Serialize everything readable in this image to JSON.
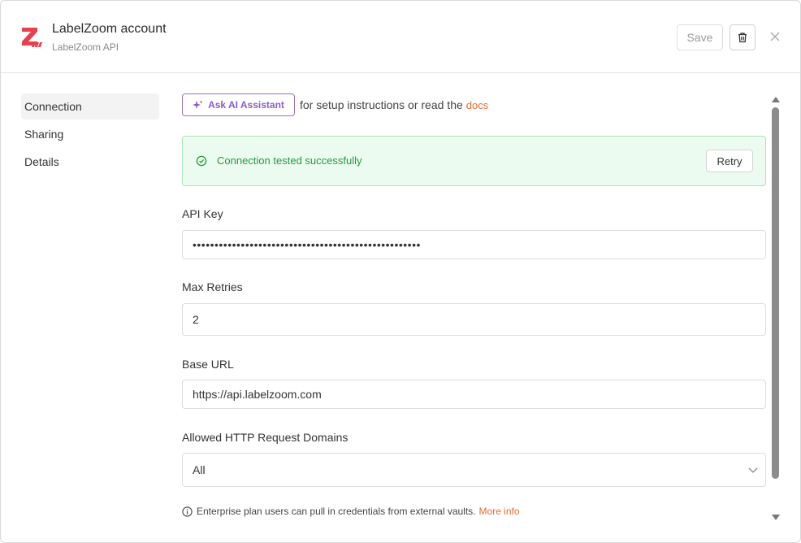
{
  "header": {
    "title": "LabelZoom account",
    "subtitle": "LabelZoom API",
    "save_label": "Save",
    "brand_color": "#e8404f"
  },
  "sidebar": {
    "items": [
      {
        "label": "Connection",
        "active": true
      },
      {
        "label": "Sharing",
        "active": false
      },
      {
        "label": "Details",
        "active": false
      }
    ]
  },
  "assistant": {
    "button_label": "Ask AI Assistant",
    "text": "for setup instructions or read the",
    "docs_label": "docs"
  },
  "status": {
    "message": "Connection tested successfully",
    "retry_label": "Retry"
  },
  "fields": {
    "api_key": {
      "label": "API Key",
      "value": "••••••••••••••••••••••••••••••••••••••••••••••••••••"
    },
    "max_retries": {
      "label": "Max Retries",
      "value": "2"
    },
    "base_url": {
      "label": "Base URL",
      "value": "https://api.labelzoom.com"
    },
    "allowed_domains": {
      "label": "Allowed HTTP Request Domains",
      "value": "All"
    }
  },
  "info": {
    "text": "Enterprise plan users can pull in credentials from external vaults.",
    "link_label": "More info"
  },
  "colors": {
    "accent_link": "#ea6a2b",
    "ai_purple": "#8e5cc8",
    "success_green": "#1f9a3c"
  }
}
